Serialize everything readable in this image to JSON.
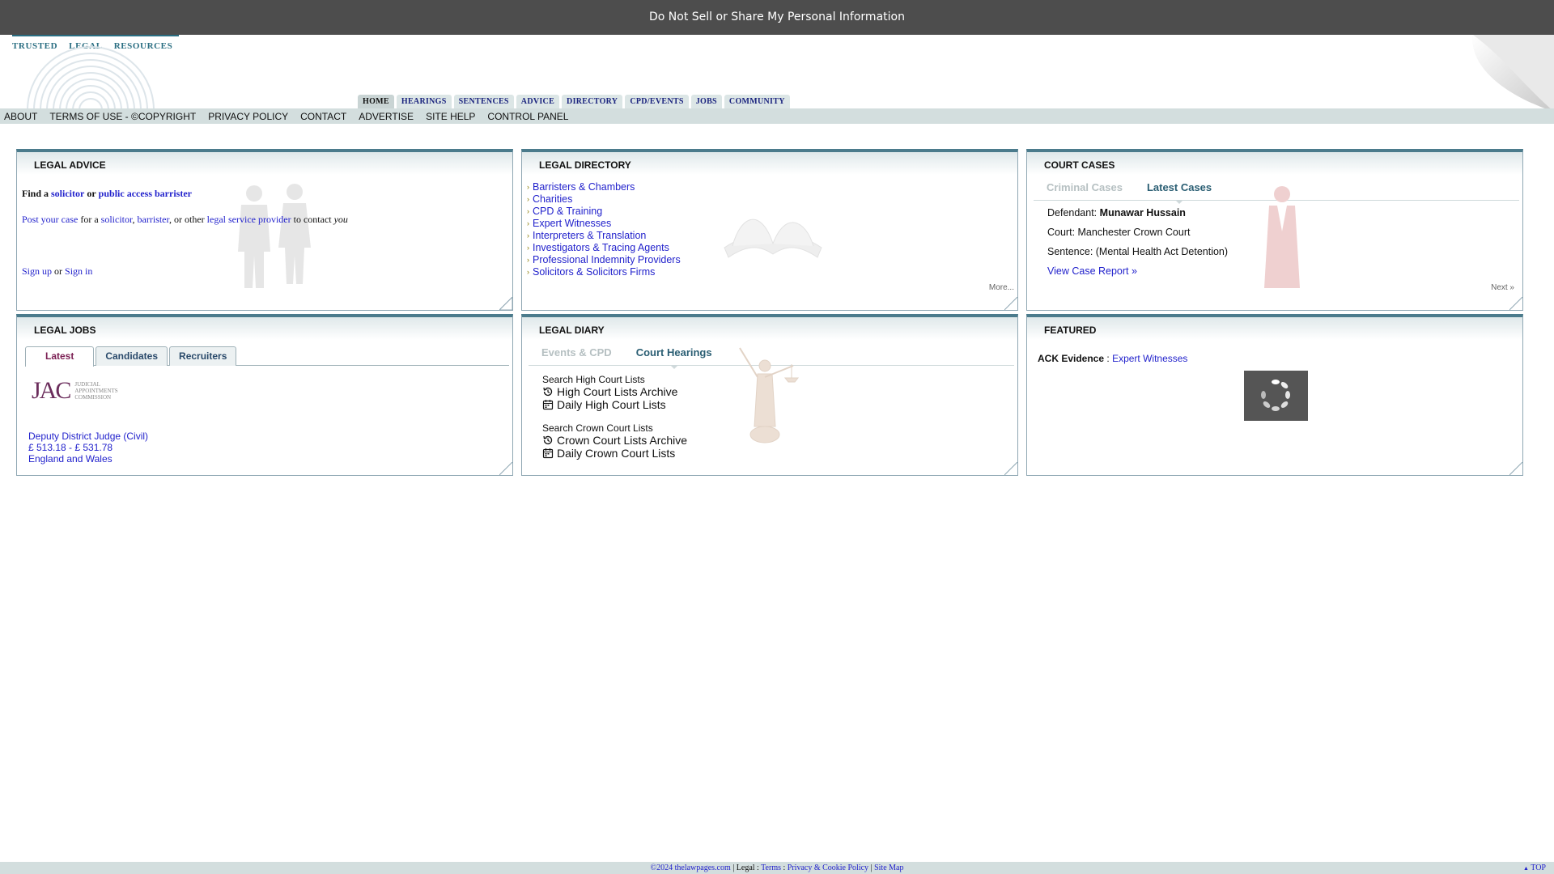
{
  "top_banner": {
    "text": "Do Not Sell or Share My Personal Information"
  },
  "brand": {
    "words": [
      "TRUSTED",
      "LEGAL",
      "RESOURCES"
    ]
  },
  "main_nav": [
    {
      "label": "HOME",
      "active": true
    },
    {
      "label": "HEARINGS"
    },
    {
      "label": "SENTENCES"
    },
    {
      "label": "ADVICE"
    },
    {
      "label": "DIRECTORY"
    },
    {
      "label": "CPD/EVENTS"
    },
    {
      "label": "JOBS"
    },
    {
      "label": "COMMUNITY"
    }
  ],
  "sub_nav": [
    "ABOUT",
    "TERMS OF USE - ©COPYRIGHT",
    "PRIVACY POLICY",
    "CONTACT",
    "ADVERTISE",
    "SITE HELP",
    "CONTROL PANEL"
  ],
  "legal_advice": {
    "title": "LEGAL ADVICE",
    "find_a": "Find a",
    "solicitor": "solicitor",
    "or": "or",
    "public_access_barrister": "public access barrister",
    "post_your_case": "Post your case",
    "for_a": "for a",
    "solicitor2": "solicitor",
    "comma1": ",",
    "barrister": "barrister",
    "or_other": ", or other",
    "legal_service_provider": "legal service provider",
    "to_contact": "to contact",
    "you": "you",
    "sign_up": "Sign up",
    "or2": "or",
    "sign_in": "Sign in"
  },
  "legal_directory": {
    "title": "LEGAL DIRECTORY",
    "items": [
      "Barristers & Chambers",
      "Charities",
      "CPD & Training",
      "Expert Witnesses",
      "Interpreters & Translation",
      "Investigators & Tracing Agents",
      "Professional Indemnity Providers",
      "Solicitors & Solicitors Firms"
    ],
    "more": "More..."
  },
  "court_cases": {
    "title": "COURT CASES",
    "tabs": [
      "Criminal Cases",
      "Latest Cases"
    ],
    "defendant_label": "Defendant:",
    "defendant": "Munawar Hussain",
    "court": "Court: Manchester Crown Court",
    "sentence": "Sentence: (Mental Health Act Detention)",
    "view_report": "View Case Report »",
    "next": "Next »"
  },
  "legal_jobs": {
    "title": "LEGAL JOBS",
    "tabs": [
      "Latest",
      "Candidates",
      "Recruiters"
    ],
    "logo_letters": "JAC",
    "logo_text": [
      "JUDICIAL",
      "APPOINTMENTS",
      "COMMISSION"
    ],
    "job_title": "Deputy District Judge (Civil)",
    "salary": "£ 513.18 - £ 531.78",
    "location": "England and Wales"
  },
  "legal_diary": {
    "title": "LEGAL DIARY",
    "tabs": [
      "Events & CPD",
      "Court Hearings"
    ],
    "high_court_heading": "Search High Court Lists",
    "high_court_archive": "High Court Lists Archive",
    "daily_high_court": "Daily High Court Lists",
    "crown_court_heading": "Search Crown Court Lists",
    "crown_court_archive": "Crown Court Lists Archive",
    "daily_crown_court": "Daily Crown Court Lists"
  },
  "featured": {
    "title": "FEATURED",
    "name": "ACK Evidence",
    "sep": ":",
    "category": "Expert Witnesses"
  },
  "footer": {
    "copyright": "©2024 thelawpages.com",
    "legal": "| Legal :",
    "terms": "Terms",
    "colon": ":",
    "privacy": "Privacy & Cookie Policy",
    "bar": "|",
    "sitemap": "Site Map",
    "top": "TOP"
  },
  "colors": {
    "topbar": "#4d4d4d",
    "brand": "#2a6e82",
    "link": "#2222cc",
    "panel_border": "#4b7b8c",
    "nav_bg": "#d3dede"
  }
}
